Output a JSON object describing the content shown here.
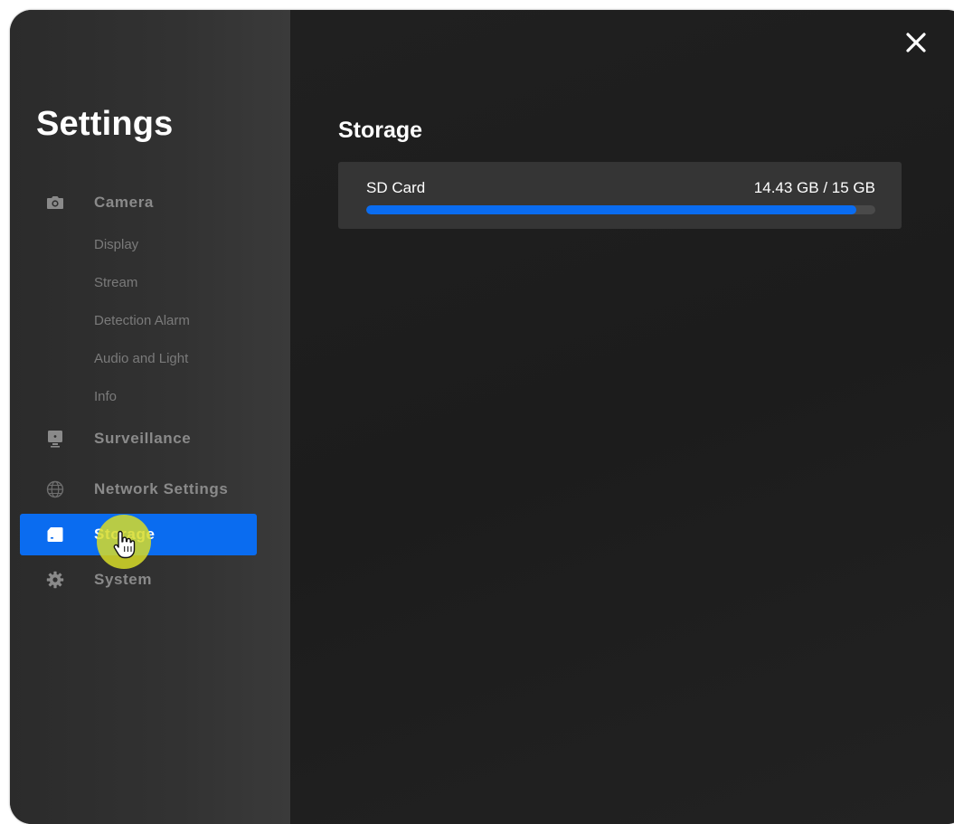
{
  "sidebar": {
    "title": "Settings",
    "items": [
      {
        "key": "camera",
        "label": "Camera",
        "icon": "camera-icon"
      },
      {
        "key": "surveillance",
        "label": "Surveillance",
        "icon": "monitor-icon"
      },
      {
        "key": "network",
        "label": "Network Settings",
        "icon": "globe-icon"
      },
      {
        "key": "storage",
        "label": "Storage",
        "icon": "sd-card-icon",
        "active": true
      },
      {
        "key": "system",
        "label": "System",
        "icon": "gear-icon"
      }
    ],
    "camera_subitems": [
      "Display",
      "Stream",
      "Detection Alarm",
      "Audio and Light",
      "Info"
    ]
  },
  "main": {
    "section_title": "Storage",
    "storage": {
      "name": "SD Card",
      "usage_text": "14.43 GB / 15 GB",
      "used_gb": 14.43,
      "total_gb": 15,
      "used_fraction": 0.962
    }
  },
  "window": {
    "close_icon": "close-icon"
  },
  "colors": {
    "accent": "#0a6cf0",
    "sidebar_bg": "#2f2f2f",
    "main_bg": "#1e1e1e",
    "card_bg": "#353535",
    "cursor_highlight": "#d7dc28"
  }
}
